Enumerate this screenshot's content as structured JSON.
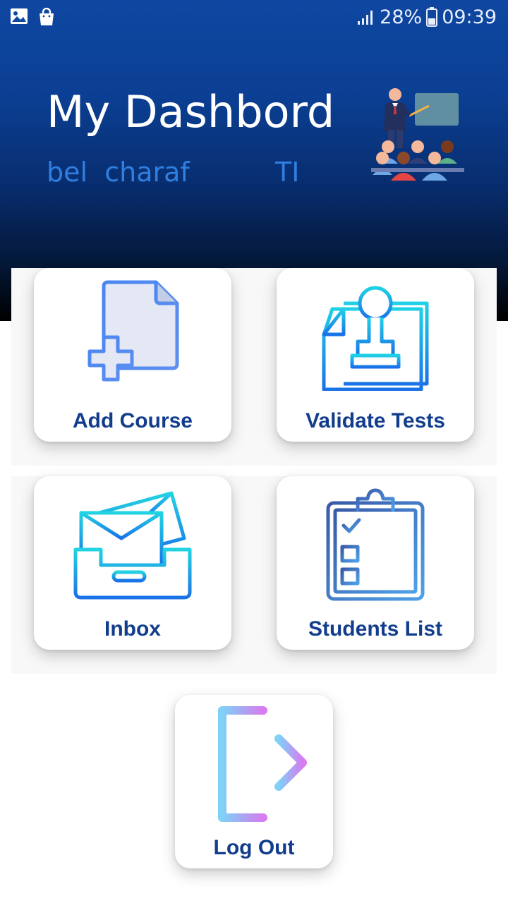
{
  "statusbar": {
    "battery_percent": "28%",
    "time": "09:39",
    "left_icons": [
      "image-icon",
      "shopping-bag-icon"
    ]
  },
  "header": {
    "title": "My Dashbord",
    "user_name": "bel  charaf",
    "user_group": "TI",
    "illustration": "teacher-classroom-icon"
  },
  "cards": {
    "add_course": "Add Course",
    "validate_tests": "Validate Tests",
    "inbox": "Inbox",
    "students_list": "Students List",
    "log_out": "Log Out"
  },
  "colors": {
    "header_top": "#0e47a1",
    "header_bottom": "#000000",
    "card_label": "#123d8c",
    "user_text": "#2f7ee0"
  }
}
